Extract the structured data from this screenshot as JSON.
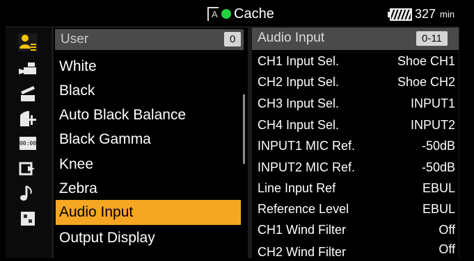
{
  "status": {
    "card_glyph": "A",
    "cache_label": "Cache",
    "battery_value": "327",
    "battery_unit": "min",
    "cache_dot_color": "#22d040"
  },
  "sidebar_icons": [
    "user-icon",
    "camera-icon",
    "clapper-icon",
    "lens-icon",
    "timecode-icon",
    "output-icon",
    "audio-note-icon",
    "grid-icon"
  ],
  "menu": {
    "header_label": "User",
    "header_badge": "0",
    "items": [
      "White",
      "Black",
      "Auto Black Balance",
      "Black Gamma",
      "Knee",
      "Zebra",
      "Audio Input",
      "Output Display"
    ],
    "selected_index": 6,
    "highlight_color": "#f5a623"
  },
  "detail": {
    "header_label": "Audio Input",
    "header_badge": "0-11",
    "rows": [
      {
        "key": "CH1 Input Sel.",
        "value": "Shoe CH1"
      },
      {
        "key": "CH2 Input Sel.",
        "value": "Shoe CH2"
      },
      {
        "key": "CH3 Input Sel.",
        "value": "INPUT1"
      },
      {
        "key": "CH4 Input Sel.",
        "value": "INPUT2"
      },
      {
        "key": "INPUT1 MIC Ref.",
        "value": "-50dB"
      },
      {
        "key": "INPUT2 MIC Ref.",
        "value": "-50dB"
      },
      {
        "key": "Line Input Ref",
        "value": "EBUL"
      },
      {
        "key": "Reference Level",
        "value": "EBUL"
      },
      {
        "key": "CH1 Wind Filter",
        "value": "Off"
      },
      {
        "key": "CH2 Wind Filter",
        "value": "Off"
      }
    ]
  }
}
